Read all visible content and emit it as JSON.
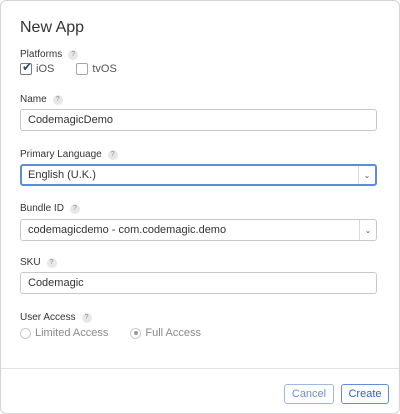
{
  "dialog": {
    "title": "New App"
  },
  "help_glyph": "?",
  "platforms": {
    "label": "Platforms",
    "options": [
      {
        "label": "iOS",
        "checked": true
      },
      {
        "label": "tvOS",
        "checked": false
      }
    ]
  },
  "name": {
    "label": "Name",
    "value": "CodemagicDemo"
  },
  "primary_language": {
    "label": "Primary Language",
    "value": "English (U.K.)"
  },
  "bundle_id": {
    "label": "Bundle ID",
    "value": "codemagicdemo - com.codemagic.demo"
  },
  "sku": {
    "label": "SKU",
    "value": "Codemagic"
  },
  "user_access": {
    "label": "User Access",
    "options": [
      {
        "label": "Limited Access",
        "selected": false
      },
      {
        "label": "Full Access",
        "selected": true
      }
    ]
  },
  "buttons": {
    "cancel": "Cancel",
    "create": "Create"
  },
  "icons": {
    "checkmark": "✔",
    "chevron": "⌄"
  },
  "colors": {
    "accent": "#3a6fc4",
    "focus_border": "#5b8ed6"
  }
}
